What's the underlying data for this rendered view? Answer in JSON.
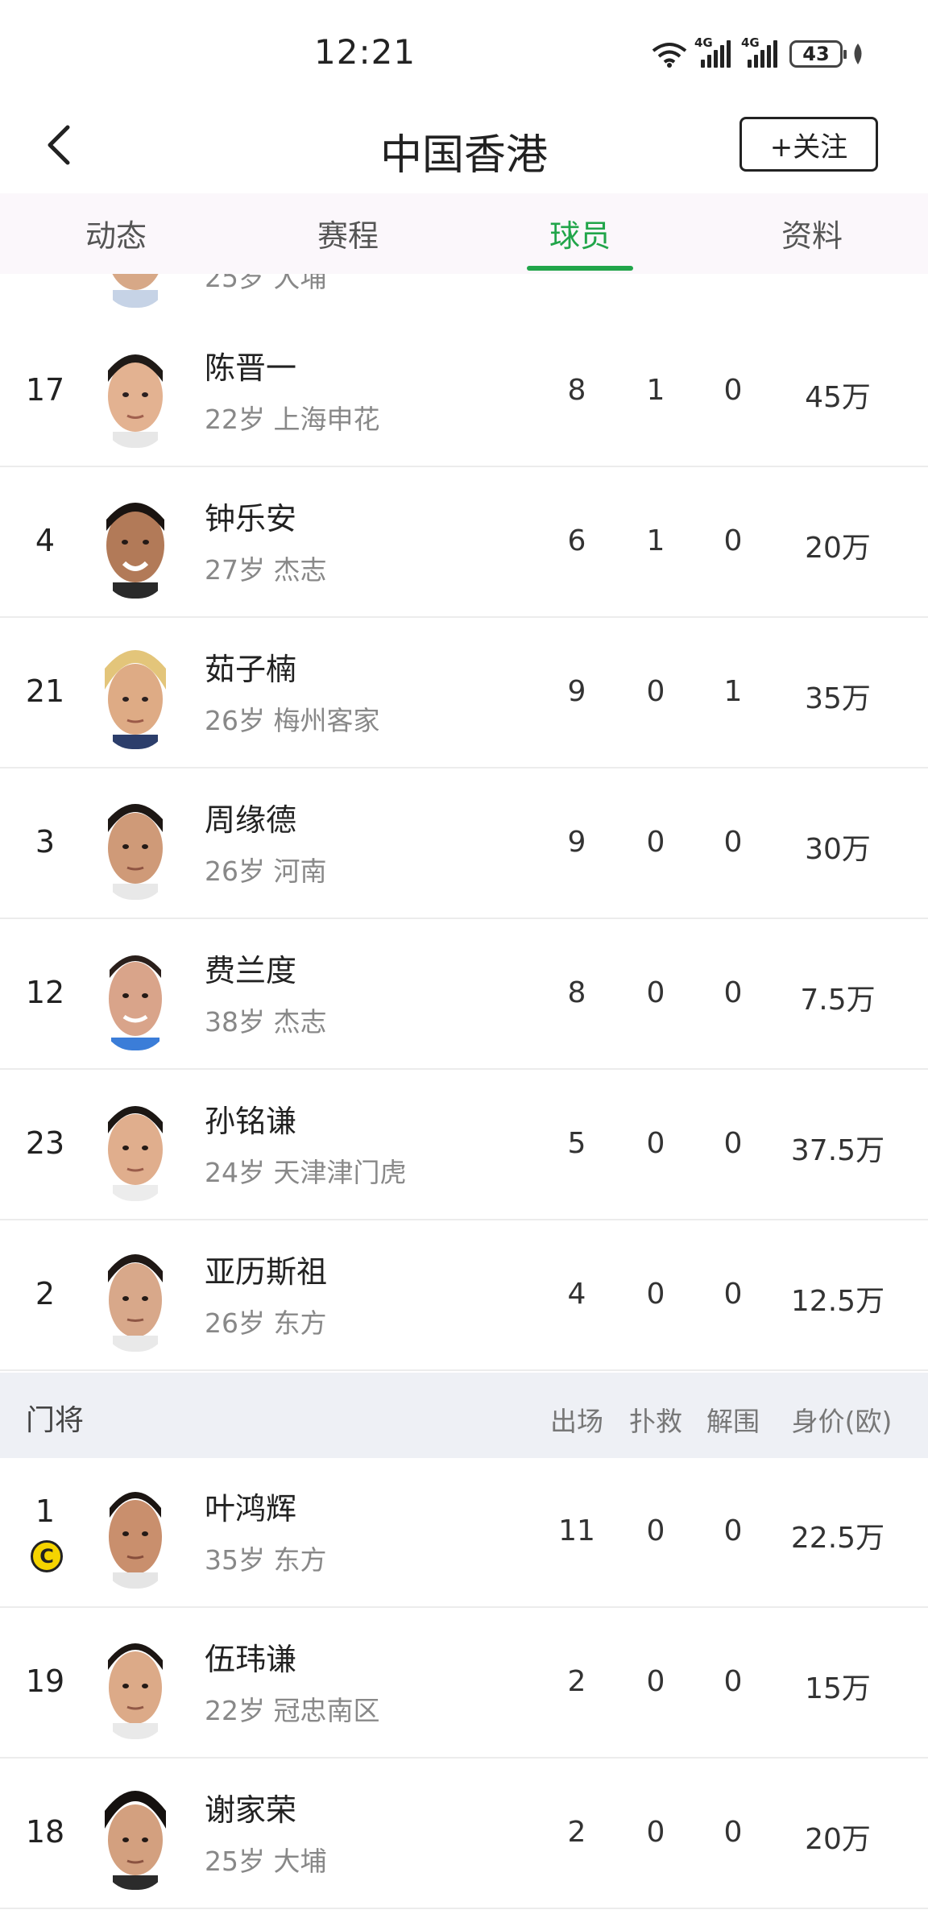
{
  "status_bar": {
    "time": "12:21",
    "network_1": "4G",
    "network_2": "4G",
    "battery": "43"
  },
  "header": {
    "title": "中国香港",
    "follow_label": "+关注"
  },
  "tabs": [
    {
      "label": "动态",
      "active": false
    },
    {
      "label": "赛程",
      "active": false
    },
    {
      "label": "球员",
      "active": true
    },
    {
      "label": "资料",
      "active": false
    }
  ],
  "partial_row": {
    "meta": "25岁 大埔"
  },
  "defenders": [
    {
      "number": "17",
      "name": "陈晋一",
      "meta": "22岁 上海申花",
      "stat1": "8",
      "stat2": "1",
      "stat3": "0",
      "value": "45万"
    },
    {
      "number": "4",
      "name": "钟乐安",
      "meta": "27岁 杰志",
      "stat1": "6",
      "stat2": "1",
      "stat3": "0",
      "value": "20万"
    },
    {
      "number": "21",
      "name": "茹子楠",
      "meta": "26岁 梅州客家",
      "stat1": "9",
      "stat2": "0",
      "stat3": "1",
      "value": "35万"
    },
    {
      "number": "3",
      "name": "周缘德",
      "meta": "26岁 河南",
      "stat1": "9",
      "stat2": "0",
      "stat3": "0",
      "value": "30万"
    },
    {
      "number": "12",
      "name": "费兰度",
      "meta": "38岁 杰志",
      "stat1": "8",
      "stat2": "0",
      "stat3": "0",
      "value": "7.5万"
    },
    {
      "number": "23",
      "name": "孙铭谦",
      "meta": "24岁 天津津门虎",
      "stat1": "5",
      "stat2": "0",
      "stat3": "0",
      "value": "37.5万"
    },
    {
      "number": "2",
      "name": "亚历斯祖",
      "meta": "26岁 东方",
      "stat1": "4",
      "stat2": "0",
      "stat3": "0",
      "value": "12.5万"
    }
  ],
  "goalkeeper_section": {
    "label": "门将",
    "columns": [
      "出场",
      "扑救",
      "解围",
      "身价(欧)"
    ]
  },
  "goalkeepers": [
    {
      "number": "1",
      "captain": "C",
      "name": "叶鸿辉",
      "meta": "35岁 东方",
      "stat1": "11",
      "stat2": "0",
      "stat3": "0",
      "value": "22.5万"
    },
    {
      "number": "19",
      "name": "伍玮谦",
      "meta": "22岁 冠忠南区",
      "stat1": "2",
      "stat2": "0",
      "stat3": "0",
      "value": "15万"
    },
    {
      "number": "18",
      "name": "谢家荣",
      "meta": "25岁 大埔",
      "stat1": "2",
      "stat2": "0",
      "stat3": "0",
      "value": "20万"
    }
  ],
  "colors": {
    "accent": "#21a54a",
    "tabs_bg": "#fbf7fb",
    "section_bg": "#eef0f5",
    "captain_badge": "#f5d400"
  }
}
